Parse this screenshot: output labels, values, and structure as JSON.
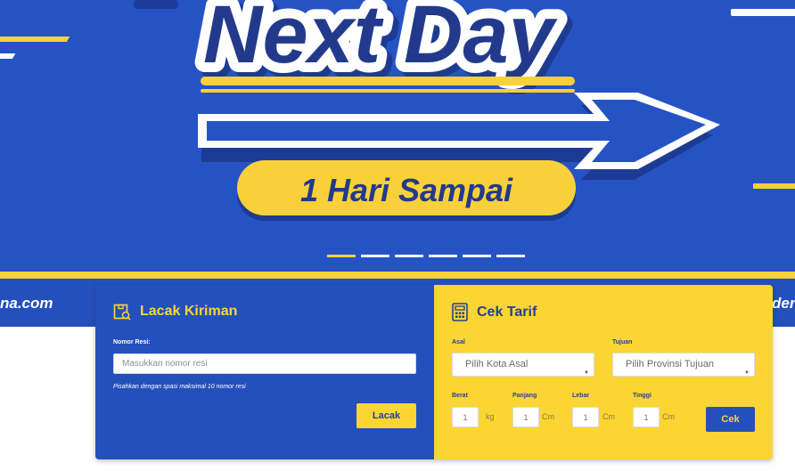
{
  "hero": {
    "headline": "Next Day",
    "tagline": "1 Hari Sampai",
    "url_left": "na.com",
    "url_right": "der",
    "slides": [
      true,
      false,
      false,
      false,
      false,
      false
    ]
  },
  "tracking": {
    "title": "Lacak Kiriman",
    "resi_label": "Nomor Resi:",
    "resi_placeholder": "Masukkan nomor resi",
    "resi_value": "",
    "hint": "Pisahkan dengan spasi maksimal 10 nomor resi",
    "button": "Lacak"
  },
  "tariff": {
    "title": "Cek Tarif",
    "origin_label": "Asal",
    "origin_value": "Pilih Kota Asal",
    "dest_label": "Tujuan",
    "dest_value": "Pilih Provinsi Tujuan",
    "weight_label": "Berat",
    "weight_value": "1",
    "weight_unit": "kg",
    "length_label": "Panjang",
    "length_value": "1",
    "length_unit": "Cm",
    "width_label": "Lebar",
    "width_value": "1",
    "width_unit": "Cm",
    "height_label": "Tinggi",
    "height_value": "1",
    "height_unit": "Cm",
    "button": "Cek"
  },
  "colors": {
    "brand_blue": "#2450bb",
    "brand_yellow": "#fbd533",
    "navy": "#24408f"
  }
}
